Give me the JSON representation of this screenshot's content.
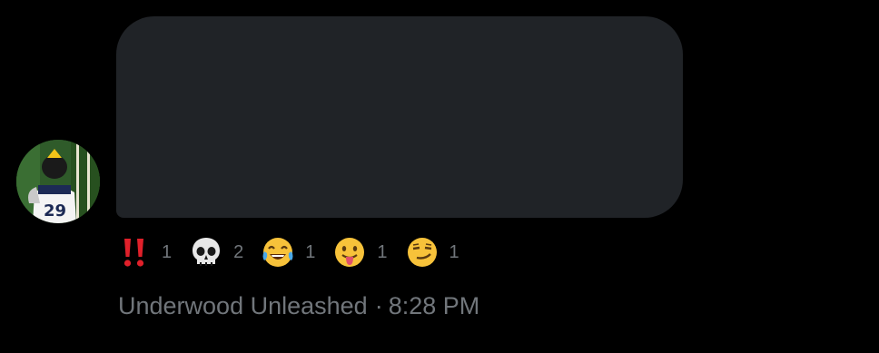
{
  "message": {
    "text": "",
    "text_omitted": true
  },
  "reactions": [
    {
      "icon": "double-exclamation-icon",
      "count": "1"
    },
    {
      "icon": "skull-icon",
      "count": "2"
    },
    {
      "icon": "tears-of-joy-icon",
      "count": "1"
    },
    {
      "icon": "tongue-out-icon",
      "count": "1"
    },
    {
      "icon": "smirk-icon",
      "count": "1"
    }
  ],
  "sender": {
    "name": "Underwood Unleashed",
    "separator": "·",
    "time": "8:28 PM",
    "avatar_icon": "user-avatar"
  },
  "colors": {
    "background": "#000000",
    "bubble": "#202327",
    "text": "#e7e9ea",
    "secondary_text": "#71767b"
  }
}
